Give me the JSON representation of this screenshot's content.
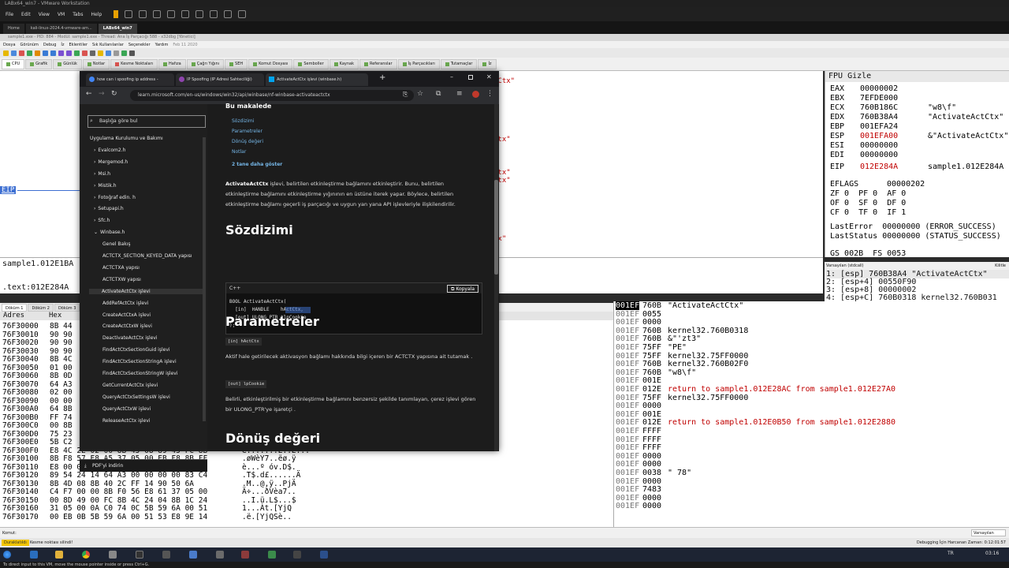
{
  "vmware": {
    "title": "LABx64_win7 - VMware Workstation",
    "menu": [
      "File",
      "Edit",
      "View",
      "VM",
      "Tabs",
      "Help"
    ],
    "tabs": [
      {
        "label": "Home",
        "active": false
      },
      {
        "label": "kali-linux-2024.4-vmware-am...",
        "active": false
      },
      {
        "label": "LABx64_win7",
        "active": true
      }
    ],
    "hint": "To direct input to this VM, move the mouse pointer inside or press Ctrl+G."
  },
  "debugger": {
    "title": "sample1.exe - PID: 884 - Modül: sample1.exe - Thread: Ana İş Parçacığı 588 - x32dbg [Yönetici]",
    "menu": [
      "Dosya",
      "Görünüm",
      "Debug",
      "İz",
      "Eklentiler",
      "Sık Kullanılanlar",
      "Seçenekler",
      "Yardım",
      "Feb 11 2020"
    ],
    "tabs": [
      {
        "label": "CPU",
        "active": true
      },
      {
        "label": "Grafik",
        "active": false
      },
      {
        "label": "Günlük",
        "active": false
      },
      {
        "label": "Notlar",
        "active": false
      },
      {
        "label": "Kesme Noktaları",
        "active": false
      },
      {
        "label": "Hafıza",
        "active": false
      },
      {
        "label": "Çağrı Yığını",
        "active": false
      },
      {
        "label": "SEH",
        "active": false
      },
      {
        "label": "Komut Dosyası",
        "active": false
      },
      {
        "label": "Semboller",
        "active": false
      },
      {
        "label": "Kaynak",
        "active": false
      },
      {
        "label": "Referanslar",
        "active": false
      },
      {
        "label": "İş Parçacıkları",
        "active": false
      },
      {
        "label": "Tutamaçlar",
        "active": false
      },
      {
        "label": "İz",
        "active": false
      }
    ],
    "cpu_comments": [
      "tCtx\"",
      "Ctx\"",
      "Ctx\"",
      "Ctx\"",
      "tx\""
    ],
    "eip_label": "EIP",
    "info": {
      "line1": "sample1.012E1BA",
      "line2": ".text:012E284A"
    },
    "registers": {
      "header": "FPU Gizle",
      "rows": [
        {
          "name": "EAX",
          "value": "00000002",
          "comment": ""
        },
        {
          "name": "EBX",
          "value": "7EFDE000",
          "comment": ""
        },
        {
          "name": "ECX",
          "value": "760B186C",
          "comment": "\"w8\\f\""
        },
        {
          "name": "EDX",
          "value": "760B38A4",
          "comment": "\"ActivateActCtx\""
        },
        {
          "name": "EBP",
          "value": "001EFA24",
          "comment": ""
        },
        {
          "name": "ESP",
          "value": "001EFA00",
          "comment": "&\"ActivateActCtx\""
        },
        {
          "name": "ESI",
          "value": "00000000",
          "comment": ""
        },
        {
          "name": "EDI",
          "value": "00000000",
          "comment": ""
        }
      ],
      "eip": {
        "name": "EIP",
        "value": "012E284A",
        "comment": "sample1.012E284A"
      },
      "eflags": {
        "name": "EFLAGS",
        "value": "00000202"
      },
      "flags": [
        "ZF 0  PF 0  AF 0",
        "OF 0  SF 0  DF 0",
        "CF 0  TF 0  IF 1"
      ],
      "last_error": "LastError  00000000 (ERROR_SUCCESS)",
      "last_status": "LastStatus 00000000 (STATUS_SUCCESS)",
      "segments": "GS 002B  FS 0053"
    },
    "args_bar": "Varsayılan (stdcall)",
    "args_bar_right": "Kilitle",
    "args": [
      "1: [esp] 760B38A4 \"ActivateActCtx\"",
      "2: [esp+4] 00550F90",
      "3: [esp+8] 00000002",
      "4: [esp+C] 760B0318 kernel32.760B031"
    ],
    "dump_tabs": [
      "Döküm 1",
      "Döküm 2",
      "Döküm 3"
    ],
    "dump_header": {
      "addr": "Adres",
      "hex": "Hex"
    },
    "dump_rows": [
      {
        "addr": "76F30000",
        "hex": "8B 44",
        "ascii": ""
      },
      {
        "addr": "76F30010",
        "hex": "90 90",
        "ascii": ""
      },
      {
        "addr": "76F30020",
        "hex": "90 90",
        "ascii": ""
      },
      {
        "addr": "76F30030",
        "hex": "90 90",
        "ascii": ""
      },
      {
        "addr": "76F30040",
        "hex": "8B 4C",
        "ascii": ""
      },
      {
        "addr": "76F30050",
        "hex": "01 00",
        "ascii": ""
      },
      {
        "addr": "76F30060",
        "hex": "8B 0D",
        "ascii": ""
      },
      {
        "addr": "76F30070",
        "hex": "64 A3",
        "ascii": ""
      },
      {
        "addr": "76F30080",
        "hex": "02 00",
        "ascii": ""
      },
      {
        "addr": "76F30090",
        "hex": "00 00",
        "ascii": ""
      },
      {
        "addr": "76F300A0",
        "hex": "64 8B",
        "ascii": ""
      },
      {
        "addr": "76F300B0",
        "hex": "FF 74",
        "ascii": ""
      },
      {
        "addr": "76F300C0",
        "hex": "00 8B",
        "ascii": ""
      },
      {
        "addr": "76F300D0",
        "hex": "75 23",
        "ascii": ""
      },
      {
        "addr": "76F300E0",
        "hex": "5B C2",
        "ascii": ""
      },
      {
        "addr": "76F300F0",
        "hex": "E8 4C 2E 02 00 8B 45 08 89 45 FC 8B",
        "ascii": "è.......E..E..."
      },
      {
        "addr": "76F30100",
        "hex": "8B F8 57 E8 A5 37 05 00 EB F8 8B FF",
        "ascii": ".øWèY7..ëø.ÿ"
      },
      {
        "addr": "76F30110",
        "hex": "E8 00 00 BA A0 F3 76 8D 44 24 10",
        "ascii": "è...º óv.D$."
      },
      {
        "addr": "76F30120",
        "hex": "89 54 24 14 64 A3 00 00 00 00 83 C4",
        "ascii": ".T$.d£......Ä"
      },
      {
        "addr": "76F30130",
        "hex": "8B 4D 08 8B 40 2C FF 14 90 50 6A",
        "ascii": ".M..@,ÿ..PjÄ"
      },
      {
        "addr": "76F30140",
        "hex": "C4 F7 00 00 8B F0 56 E8 61 37 05 00",
        "ascii": "Ä÷...ðVèa7.."
      },
      {
        "addr": "76F30150",
        "hex": "00 8D 49 00 FC 8B 4C 24 04 8B 1C 24",
        "ascii": "..I.ü.L$...$"
      },
      {
        "addr": "76F30160",
        "hex": "31 05 00 0A C0 74 0C 5B 59 6A 00 51",
        "ascii": "1...Àt.[YjQ"
      },
      {
        "addr": "76F30170",
        "hex": "00 EB 0B 5B 59 6A 00 51 53 E8 9E 14",
        "ascii": ".ë.[YjQSè.."
      }
    ],
    "stack_rows": [
      {
        "addr": "001EF",
        "val": "760B",
        "com": "\"ActivateActCtx\"",
        "red": false
      },
      {
        "addr": "001EF",
        "val": "0055",
        "com": "",
        "red": false
      },
      {
        "addr": "001EF",
        "val": "0000",
        "com": "",
        "red": false
      },
      {
        "addr": "001EF",
        "val": "760B",
        "com": "kernel32.760B0318",
        "red": false
      },
      {
        "addr": "001EF",
        "val": "760B",
        "com": "&\"'zt3\"",
        "red": false
      },
      {
        "addr": "001EF",
        "val": "75FF",
        "com": "\"PE\"",
        "red": false
      },
      {
        "addr": "001EF",
        "val": "75FF",
        "com": "kernel32.75FF0000",
        "red": false
      },
      {
        "addr": "001EF",
        "val": "760B",
        "com": "kernel32.760B02F0",
        "red": false
      },
      {
        "addr": "001EF",
        "val": "760B",
        "com": "\"w8\\f\"",
        "red": false
      },
      {
        "addr": "001EF",
        "val": "001E",
        "com": "",
        "red": false
      },
      {
        "addr": "001EF",
        "val": "012E",
        "com": "return to sample1.012E28AC from sample1.012E27A0",
        "red": true
      },
      {
        "addr": "001EF",
        "val": "75FF",
        "com": "kernel32.75FF0000",
        "red": false
      },
      {
        "addr": "001EF",
        "val": "0000",
        "com": "",
        "red": false
      },
      {
        "addr": "001EF",
        "val": "001E",
        "com": "",
        "red": false
      },
      {
        "addr": "001EF",
        "val": "012E",
        "com": "return to sample1.012E0B50 from sample1.012E2880",
        "red": true
      },
      {
        "addr": "001EF",
        "val": "FFFF",
        "com": "",
        "red": false
      },
      {
        "addr": "001EF",
        "val": "FFFF",
        "com": "",
        "red": false
      },
      {
        "addr": "001EF",
        "val": "FFFF",
        "com": "",
        "red": false
      },
      {
        "addr": "001EF",
        "val": "0000",
        "com": "",
        "red": false
      },
      {
        "addr": "001EF",
        "val": "0000",
        "com": "",
        "red": false
      },
      {
        "addr": "001EF",
        "val": "0038",
        "com": "\" 78\"",
        "red": false
      },
      {
        "addr": "001EF",
        "val": "0000",
        "com": "",
        "red": false
      },
      {
        "addr": "001EF",
        "val": "7483",
        "com": "",
        "red": false
      },
      {
        "addr": "001EF",
        "val": "0000",
        "com": "",
        "red": false
      },
      {
        "addr": "001EF",
        "val": "0000",
        "com": "",
        "red": false
      }
    ],
    "command_label": "Komut:",
    "status": {
      "paused": "Duraklatıldı",
      "message": "Kesme noktası silindi!",
      "time": "Debugging İçin Harcanan Zaman: 0:12:01:57"
    }
  },
  "browser": {
    "tabs": [
      {
        "label": "how can i spoofing ip address - ",
        "fav": "#4285f4",
        "active": false
      },
      {
        "label": "IP Spoofing (IP Adresi Sahteciliği)",
        "fav": "#8e44ad",
        "active": false
      },
      {
        "label": "ActivateActCtx işlevi (winbase.h)",
        "fav": "#00a4ef",
        "active": true
      }
    ],
    "url": "learn.microsoft.com/en-us/windows/win32/api/winbase/nf-winbase-activateactctx",
    "filter_placeholder": "Başlığa göre bul",
    "nav": [
      {
        "label": "Uygulama Kurulumu ve Bakımı",
        "indent": 0,
        "prefix": "",
        "active": false
      },
      {
        "label": "Evalcom2.h",
        "indent": 1,
        "prefix": "›",
        "active": false
      },
      {
        "label": "Mergemod.h",
        "indent": 1,
        "prefix": "›",
        "active": false
      },
      {
        "label": "Msi.h",
        "indent": 1,
        "prefix": "›",
        "active": false
      },
      {
        "label": "Mistik.h",
        "indent": 1,
        "prefix": "›",
        "active": false
      },
      {
        "label": "Fotoğraf edin. h",
        "indent": 1,
        "prefix": "›",
        "active": false
      },
      {
        "label": "Setupapi.h",
        "indent": 1,
        "prefix": "›",
        "active": false
      },
      {
        "label": "Sfc.h",
        "indent": 1,
        "prefix": "›",
        "active": false
      },
      {
        "label": "Winbase.h",
        "indent": 1,
        "prefix": "⌄",
        "active": false
      },
      {
        "label": "Genel Bakış",
        "indent": 2,
        "prefix": "",
        "active": false
      },
      {
        "label": "ACTCTX_SECTION_KEYED_DATA yapısı",
        "indent": 2,
        "prefix": "",
        "active": false
      },
      {
        "label": "ACTCTXA yapısı",
        "indent": 2,
        "prefix": "",
        "active": false
      },
      {
        "label": "ACTCTXW yapısı",
        "indent": 2,
        "prefix": "",
        "active": false
      },
      {
        "label": "ActivateActCtx işlevi",
        "indent": 2,
        "prefix": "",
        "active": true
      },
      {
        "label": "AddRefActCtx işlevi",
        "indent": 2,
        "prefix": "",
        "active": false
      },
      {
        "label": "CreateActCtxA işlevi",
        "indent": 2,
        "prefix": "",
        "active": false
      },
      {
        "label": "CreateActCtxW işlevi",
        "indent": 2,
        "prefix": "",
        "active": false
      },
      {
        "label": "DeactivateActCtx işlevi",
        "indent": 2,
        "prefix": "",
        "active": false
      },
      {
        "label": "FindActCtxSectionGuid işlevi",
        "indent": 2,
        "prefix": "",
        "active": false
      },
      {
        "label": "FindActCtxSectionStringA işlevi",
        "indent": 2,
        "prefix": "",
        "active": false
      },
      {
        "label": "FindActCtxSectionStringW işlevi",
        "indent": 2,
        "prefix": "",
        "active": false
      },
      {
        "label": "GetCurrentActCtx işlevi",
        "indent": 2,
        "prefix": "",
        "active": false
      },
      {
        "label": "QueryActCtxSettingsW işlevi",
        "indent": 2,
        "prefix": "",
        "active": false
      },
      {
        "label": "QueryActCtxW işlevi",
        "indent": 2,
        "prefix": "",
        "active": false
      },
      {
        "label": "ReleaseActCtx işlevi",
        "indent": 2,
        "prefix": "",
        "active": false
      }
    ],
    "pdf_label": "PDF'yi indirin",
    "article": {
      "toc_heading": "Bu makalede",
      "toc": [
        "Sözdizimi",
        "Parametreler",
        "Dönüş değeri",
        "Notlar"
      ],
      "toc_more": "2 tane daha göster",
      "intro_bold": "ActivateActCtx",
      "intro": " işlevi, belirtilen etkinleştirme bağlamını etkinleştirir. Bunu, belirtilen etkinleştirme bağlamını etkinleştirme yığınının en üstüne iterek yapar. Böylece, belirtilen etkinleştirme bağlamı geçerli iş parçacığı ve uygun yan yana API işlevleriyle ilişkilendirilir.",
      "syntax_heading": "Sözdizimi",
      "code_lang": "C++",
      "copy_label": "Kopyala",
      "code_lines": [
        "BOOL ActivateActCtx(",
        "  [in]  HANDLE    hActCtx,",
        "  [out] ULONG_PTR *lpCookie",
        ");"
      ],
      "params_heading": "Parametreler",
      "param1": "[in] hActCtx",
      "param1_desc": "Aktif hale getirilecek aktivasyon bağlamı hakkında bilgi içeren bir ACTCTX yapısına ait tutamak .",
      "param2": "[out] lpCookie",
      "param2_desc": "Belirli, etkinleştirilmiş bir etkinleştirme bağlamını benzersiz şekilde tanımlayan, çerez işlevi gören bir ULONG_PTR'ye işaretçi .",
      "return_heading": "Dönüş değeri"
    }
  },
  "taskbar": {
    "lang": "TR",
    "time": "03:16"
  }
}
